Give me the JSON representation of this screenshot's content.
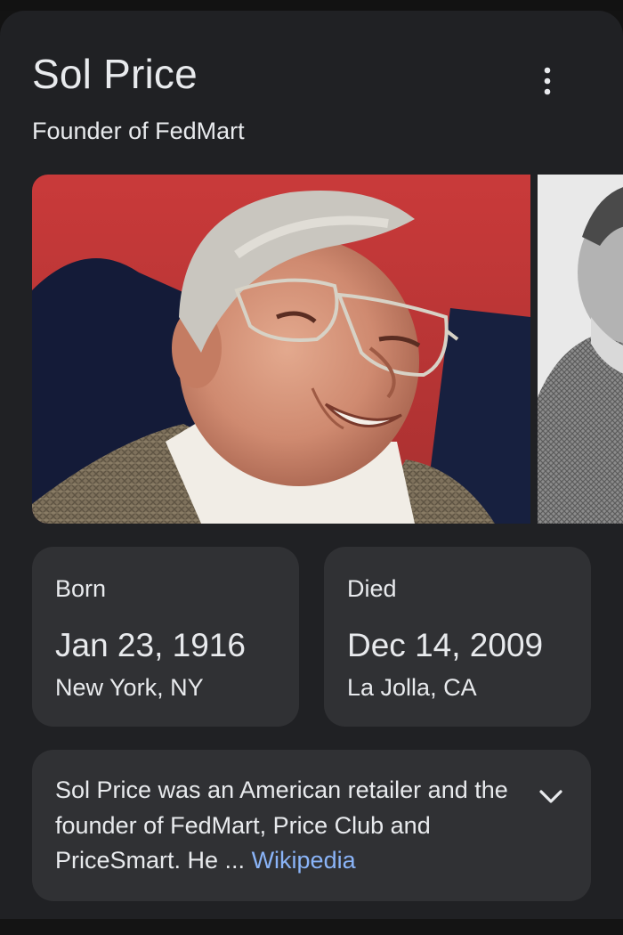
{
  "header": {
    "title": "Sol Price",
    "subtitle": "Founder of FedMart",
    "menu_icon": "more-vert-icon"
  },
  "images": [
    {
      "label": "photo-1"
    },
    {
      "label": "photo-2"
    }
  ],
  "facts": {
    "born": {
      "label": "Born",
      "date": "Jan 23, 1916",
      "place": "New York, NY"
    },
    "died": {
      "label": "Died",
      "date": "Dec 14, 2009",
      "place": "La Jolla, CA"
    }
  },
  "description": {
    "text": "Sol Price was an American retailer and the founder of FedMart, Price Club and PriceSmart. He",
    "ellipsis": " ... ",
    "source_link": "Wikipedia",
    "expand_icon": "chevron-down-icon"
  },
  "colors": {
    "background": "#202124",
    "card": "#303134",
    "text": "#e8eaed",
    "link": "#8ab4f8"
  }
}
